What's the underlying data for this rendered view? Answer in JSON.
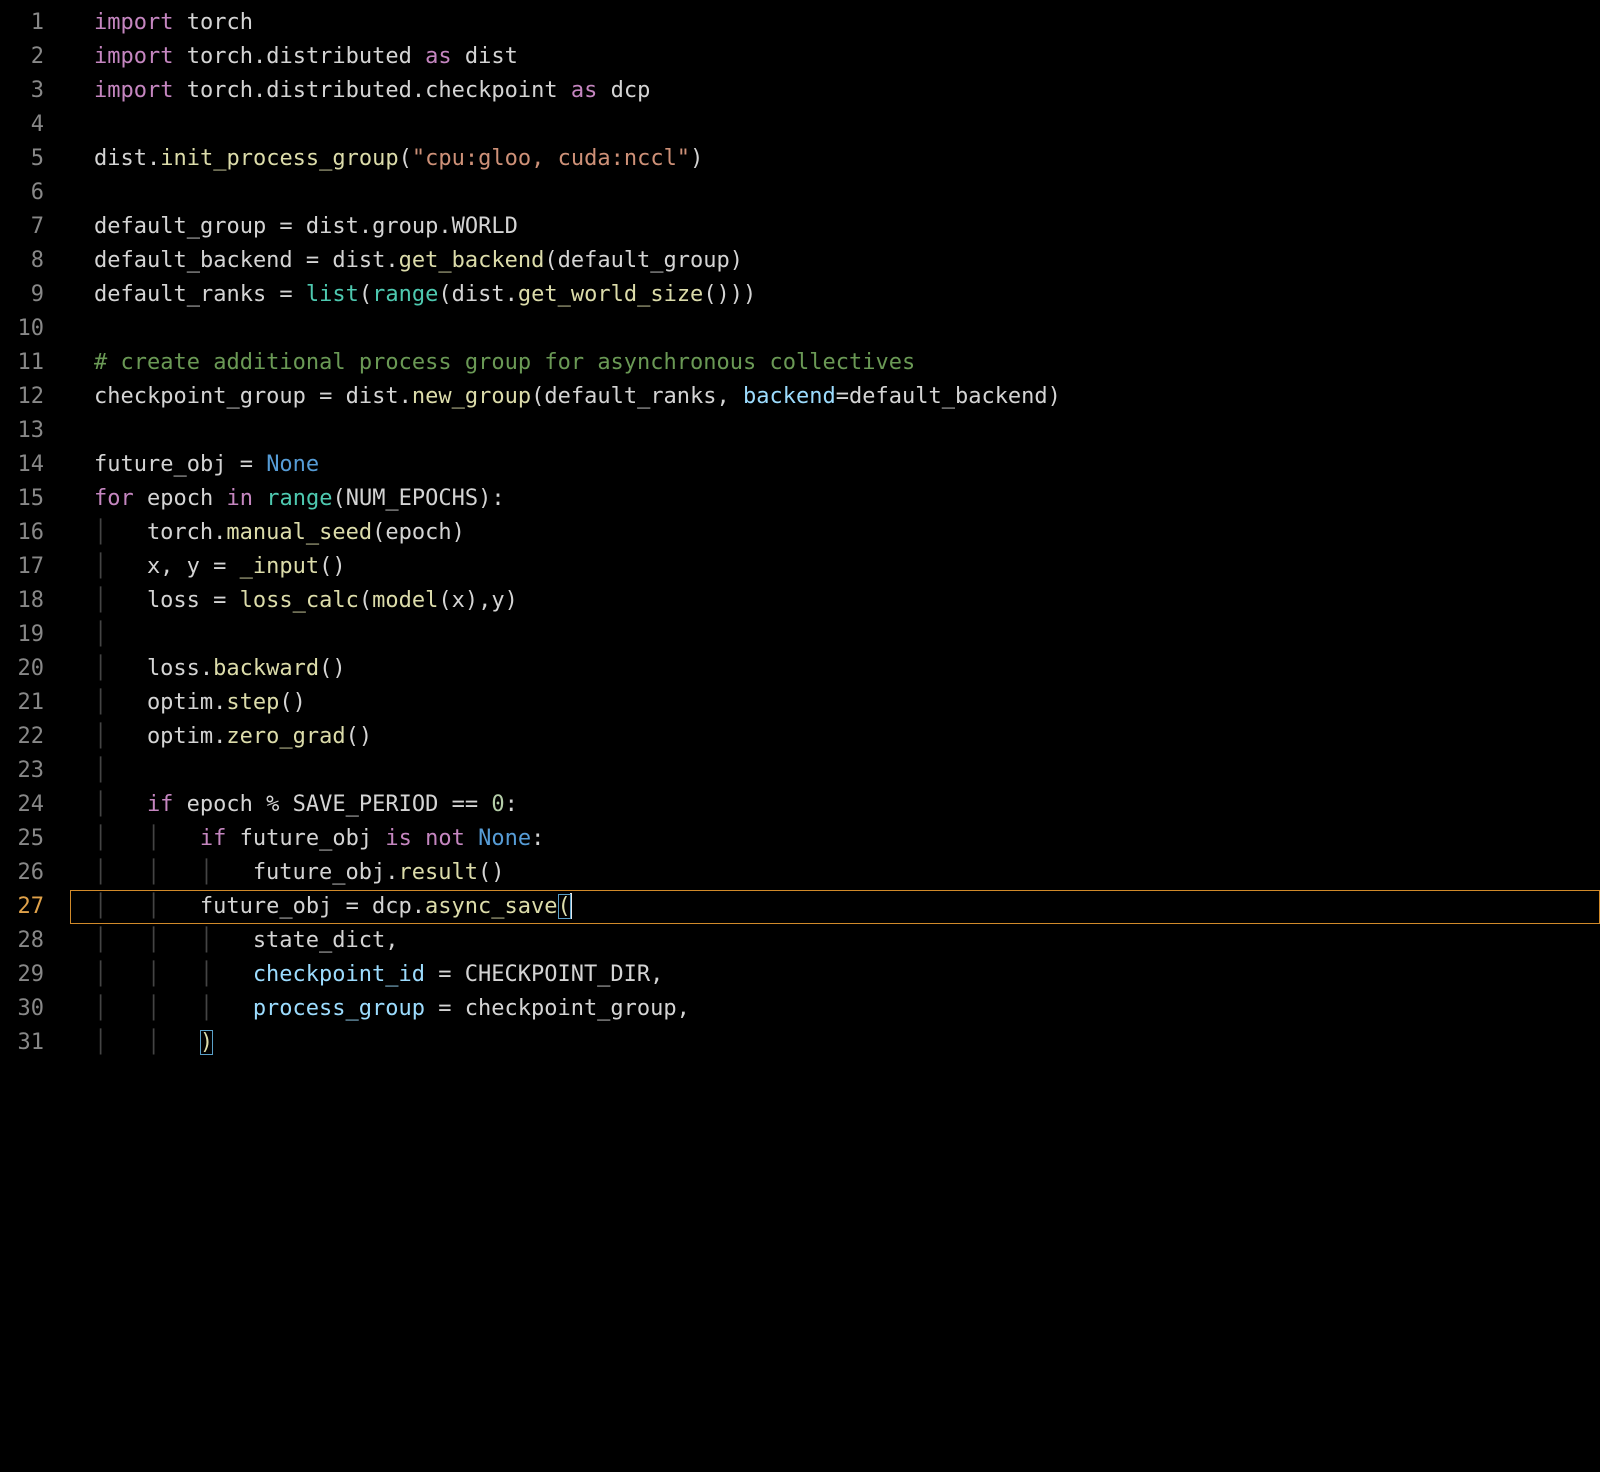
{
  "highlighted_line_number": 27,
  "lines": [
    {
      "n": 1,
      "indent": 0,
      "tokens": [
        {
          "t": "kw",
          "v": "import"
        },
        {
          "t": "op",
          "v": " "
        },
        {
          "t": "nm",
          "v": "torch"
        }
      ]
    },
    {
      "n": 2,
      "indent": 0,
      "tokens": [
        {
          "t": "kw",
          "v": "import"
        },
        {
          "t": "op",
          "v": " "
        },
        {
          "t": "nm",
          "v": "torch.distributed"
        },
        {
          "t": "op",
          "v": " "
        },
        {
          "t": "kw",
          "v": "as"
        },
        {
          "t": "op",
          "v": " "
        },
        {
          "t": "nm",
          "v": "dist"
        }
      ]
    },
    {
      "n": 3,
      "indent": 0,
      "tokens": [
        {
          "t": "kw",
          "v": "import"
        },
        {
          "t": "op",
          "v": " "
        },
        {
          "t": "nm",
          "v": "torch.distributed.checkpoint"
        },
        {
          "t": "op",
          "v": " "
        },
        {
          "t": "kw",
          "v": "as"
        },
        {
          "t": "op",
          "v": " "
        },
        {
          "t": "nm",
          "v": "dcp"
        }
      ]
    },
    {
      "n": 4,
      "indent": 0,
      "tokens": []
    },
    {
      "n": 5,
      "indent": 0,
      "tokens": [
        {
          "t": "nm",
          "v": "dist."
        },
        {
          "t": "fn",
          "v": "init_process_group"
        },
        {
          "t": "op",
          "v": "("
        },
        {
          "t": "str",
          "v": "\"cpu:gloo, cuda:nccl\""
        },
        {
          "t": "op",
          "v": ")"
        }
      ]
    },
    {
      "n": 6,
      "indent": 0,
      "tokens": []
    },
    {
      "n": 7,
      "indent": 0,
      "tokens": [
        {
          "t": "nm",
          "v": "default_group = dist.group.WORLD"
        }
      ]
    },
    {
      "n": 8,
      "indent": 0,
      "tokens": [
        {
          "t": "nm",
          "v": "default_backend = dist."
        },
        {
          "t": "fn",
          "v": "get_backend"
        },
        {
          "t": "op",
          "v": "(default_group)"
        }
      ]
    },
    {
      "n": 9,
      "indent": 0,
      "tokens": [
        {
          "t": "nm",
          "v": "default_ranks = "
        },
        {
          "t": "bfn",
          "v": "list"
        },
        {
          "t": "op",
          "v": "("
        },
        {
          "t": "bfn",
          "v": "range"
        },
        {
          "t": "op",
          "v": "(dist."
        },
        {
          "t": "fn",
          "v": "get_world_size"
        },
        {
          "t": "op",
          "v": "()))"
        }
      ]
    },
    {
      "n": 10,
      "indent": 0,
      "tokens": []
    },
    {
      "n": 11,
      "indent": 0,
      "tokens": [
        {
          "t": "com",
          "v": "# create additional process group for asynchronous collectives"
        }
      ]
    },
    {
      "n": 12,
      "indent": 0,
      "tokens": [
        {
          "t": "nm",
          "v": "checkpoint_group = dist."
        },
        {
          "t": "fn",
          "v": "new_group"
        },
        {
          "t": "op",
          "v": "(default_ranks, "
        },
        {
          "t": "arg",
          "v": "backend"
        },
        {
          "t": "op",
          "v": "=default_backend)"
        }
      ]
    },
    {
      "n": 13,
      "indent": 0,
      "tokens": []
    },
    {
      "n": 14,
      "indent": 0,
      "tokens": [
        {
          "t": "nm",
          "v": "future_obj = "
        },
        {
          "t": "none",
          "v": "None"
        }
      ]
    },
    {
      "n": 15,
      "indent": 0,
      "tokens": [
        {
          "t": "kw",
          "v": "for"
        },
        {
          "t": "op",
          "v": " epoch "
        },
        {
          "t": "kw",
          "v": "in"
        },
        {
          "t": "op",
          "v": " "
        },
        {
          "t": "bfn",
          "v": "range"
        },
        {
          "t": "op",
          "v": "(NUM_EPOCHS):"
        }
      ]
    },
    {
      "n": 16,
      "indent": 1,
      "tokens": [
        {
          "t": "nm",
          "v": "torch."
        },
        {
          "t": "fn",
          "v": "manual_seed"
        },
        {
          "t": "op",
          "v": "(epoch)"
        }
      ]
    },
    {
      "n": 17,
      "indent": 1,
      "tokens": [
        {
          "t": "nm",
          "v": "x, y = "
        },
        {
          "t": "fn",
          "v": "_input"
        },
        {
          "t": "op",
          "v": "()"
        }
      ]
    },
    {
      "n": 18,
      "indent": 1,
      "tokens": [
        {
          "t": "nm",
          "v": "loss = "
        },
        {
          "t": "fn",
          "v": "loss_calc"
        },
        {
          "t": "op",
          "v": "("
        },
        {
          "t": "fn",
          "v": "model"
        },
        {
          "t": "op",
          "v": "(x),y)"
        }
      ]
    },
    {
      "n": 19,
      "indent": 1,
      "tokens": []
    },
    {
      "n": 20,
      "indent": 1,
      "tokens": [
        {
          "t": "nm",
          "v": "loss."
        },
        {
          "t": "fn",
          "v": "backward"
        },
        {
          "t": "op",
          "v": "()"
        }
      ]
    },
    {
      "n": 21,
      "indent": 1,
      "tokens": [
        {
          "t": "nm",
          "v": "optim."
        },
        {
          "t": "fn",
          "v": "step"
        },
        {
          "t": "op",
          "v": "()"
        }
      ]
    },
    {
      "n": 22,
      "indent": 1,
      "tokens": [
        {
          "t": "nm",
          "v": "optim."
        },
        {
          "t": "fn",
          "v": "zero_grad"
        },
        {
          "t": "op",
          "v": "()"
        }
      ]
    },
    {
      "n": 23,
      "indent": 1,
      "tokens": []
    },
    {
      "n": 24,
      "indent": 1,
      "tokens": [
        {
          "t": "kw",
          "v": "if"
        },
        {
          "t": "op",
          "v": " epoch % SAVE_PERIOD == "
        },
        {
          "t": "num",
          "v": "0"
        },
        {
          "t": "op",
          "v": ":"
        }
      ]
    },
    {
      "n": 25,
      "indent": 2,
      "tokens": [
        {
          "t": "kw",
          "v": "if"
        },
        {
          "t": "op",
          "v": " future_obj "
        },
        {
          "t": "kw",
          "v": "is"
        },
        {
          "t": "op",
          "v": " "
        },
        {
          "t": "kw",
          "v": "not"
        },
        {
          "t": "op",
          "v": " "
        },
        {
          "t": "none",
          "v": "None"
        },
        {
          "t": "op",
          "v": ":"
        }
      ]
    },
    {
      "n": 26,
      "indent": 3,
      "tokens": [
        {
          "t": "nm",
          "v": "future_obj."
        },
        {
          "t": "fn",
          "v": "result"
        },
        {
          "t": "op",
          "v": "()"
        }
      ]
    },
    {
      "n": 27,
      "indent": 2,
      "hl": true,
      "tokens": [
        {
          "t": "nm",
          "v": "future_obj = dcp."
        },
        {
          "t": "fn",
          "v": "async_save"
        },
        {
          "t": "paren-hl",
          "v": "("
        },
        {
          "t": "cursor",
          "v": ""
        }
      ]
    },
    {
      "n": 28,
      "indent": 3,
      "tokens": [
        {
          "t": "nm",
          "v": "state_dict,"
        }
      ]
    },
    {
      "n": 29,
      "indent": 3,
      "tokens": [
        {
          "t": "arg",
          "v": "checkpoint_id"
        },
        {
          "t": "op",
          "v": " = CHECKPOINT_DIR,"
        }
      ]
    },
    {
      "n": 30,
      "indent": 3,
      "tokens": [
        {
          "t": "arg",
          "v": "process_group"
        },
        {
          "t": "op",
          "v": " = checkpoint_group,"
        }
      ]
    },
    {
      "n": 31,
      "indent": 2,
      "tokens": [
        {
          "t": "paren-hl",
          "v": ")"
        }
      ]
    }
  ]
}
